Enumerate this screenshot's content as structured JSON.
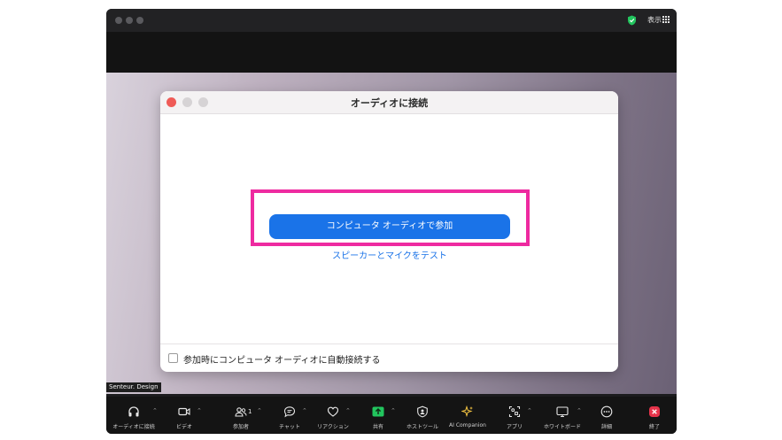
{
  "window": {
    "view_label": "表示",
    "name_tag": "Senteur. Design"
  },
  "dialog": {
    "title": "オーディオに接続",
    "join_button": "コンピュータ オーディオで参加",
    "test_link": "スピーカーとマイクをテスト",
    "auto_join_label": "参加時にコンピュータ オーディオに自動接続する",
    "auto_join_checked": false
  },
  "toolbar": {
    "items": [
      {
        "label": "オーディオに接続",
        "icon": "headphones-icon"
      },
      {
        "label": "ビデオ",
        "icon": "video-camera-icon"
      },
      {
        "label": "参加者",
        "icon": "participants-icon",
        "count": "1"
      },
      {
        "label": "チャット",
        "icon": "chat-icon"
      },
      {
        "label": "リアクション",
        "icon": "heart-icon"
      },
      {
        "label": "共有",
        "icon": "share-arrow-icon"
      },
      {
        "label": "ホストツール",
        "icon": "shield-icon"
      },
      {
        "label": "AI Companion",
        "icon": "sparkle-icon"
      },
      {
        "label": "アプリ",
        "icon": "apps-icon"
      },
      {
        "label": "ホワイトボード",
        "icon": "whiteboard-icon"
      },
      {
        "label": "詳細",
        "icon": "more-icon"
      },
      {
        "label": "終了",
        "icon": "end-icon"
      }
    ]
  },
  "colors": {
    "accent": "#1a73e8",
    "highlight": "#ee2aa0",
    "share_green": "#22c55e",
    "end_red": "#e5334a",
    "ai_yellow": "#f5c542"
  }
}
